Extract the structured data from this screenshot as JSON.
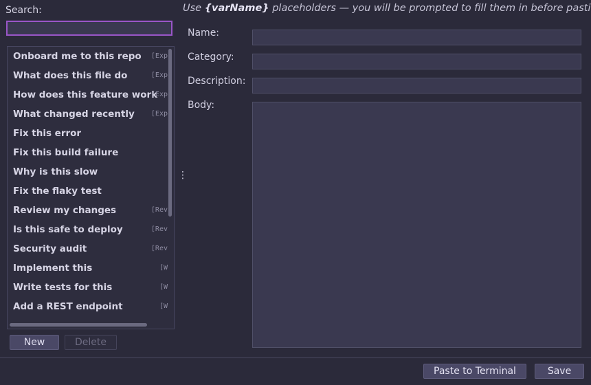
{
  "search": {
    "label": "Search:",
    "value": ""
  },
  "list": {
    "items": [
      {
        "title": "Onboard me to this repo",
        "tag": "[Exp"
      },
      {
        "title": "What does this file do",
        "tag": "[Exp"
      },
      {
        "title": "How does this feature work",
        "tag": "[Exp"
      },
      {
        "title": "What changed recently",
        "tag": "[Exp"
      },
      {
        "title": "Fix this error",
        "tag": ""
      },
      {
        "title": "Fix this build failure",
        "tag": ""
      },
      {
        "title": "Why is this slow",
        "tag": ""
      },
      {
        "title": "Fix the flaky test",
        "tag": ""
      },
      {
        "title": "Review my changes",
        "tag": "[Rev"
      },
      {
        "title": "Is this safe to deploy",
        "tag": "[Rev"
      },
      {
        "title": "Security audit",
        "tag": "[Rev"
      },
      {
        "title": "Implement this",
        "tag": "[W"
      },
      {
        "title": "Write tests for this",
        "tag": "[W"
      },
      {
        "title": "Add a REST endpoint",
        "tag": "[W"
      }
    ]
  },
  "buttons": {
    "new": "New",
    "delete": "Delete",
    "paste": "Paste to Terminal",
    "save": "Save"
  },
  "hint": {
    "prefix": "Use ",
    "placeholder": "{varName}",
    "suffix": " placeholders — you will be prompted to fill them in before pasting."
  },
  "form": {
    "name_label": "Name:",
    "category_label": "Category:",
    "description_label": "Description:",
    "body_label": "Body:",
    "name_value": "",
    "category_value": "",
    "description_value": "",
    "body_value": ""
  },
  "divider_glyph": "⋮",
  "colors": {
    "background": "#2b2a3a",
    "field": "#3a3950",
    "focus_border": "#9a56c8"
  }
}
